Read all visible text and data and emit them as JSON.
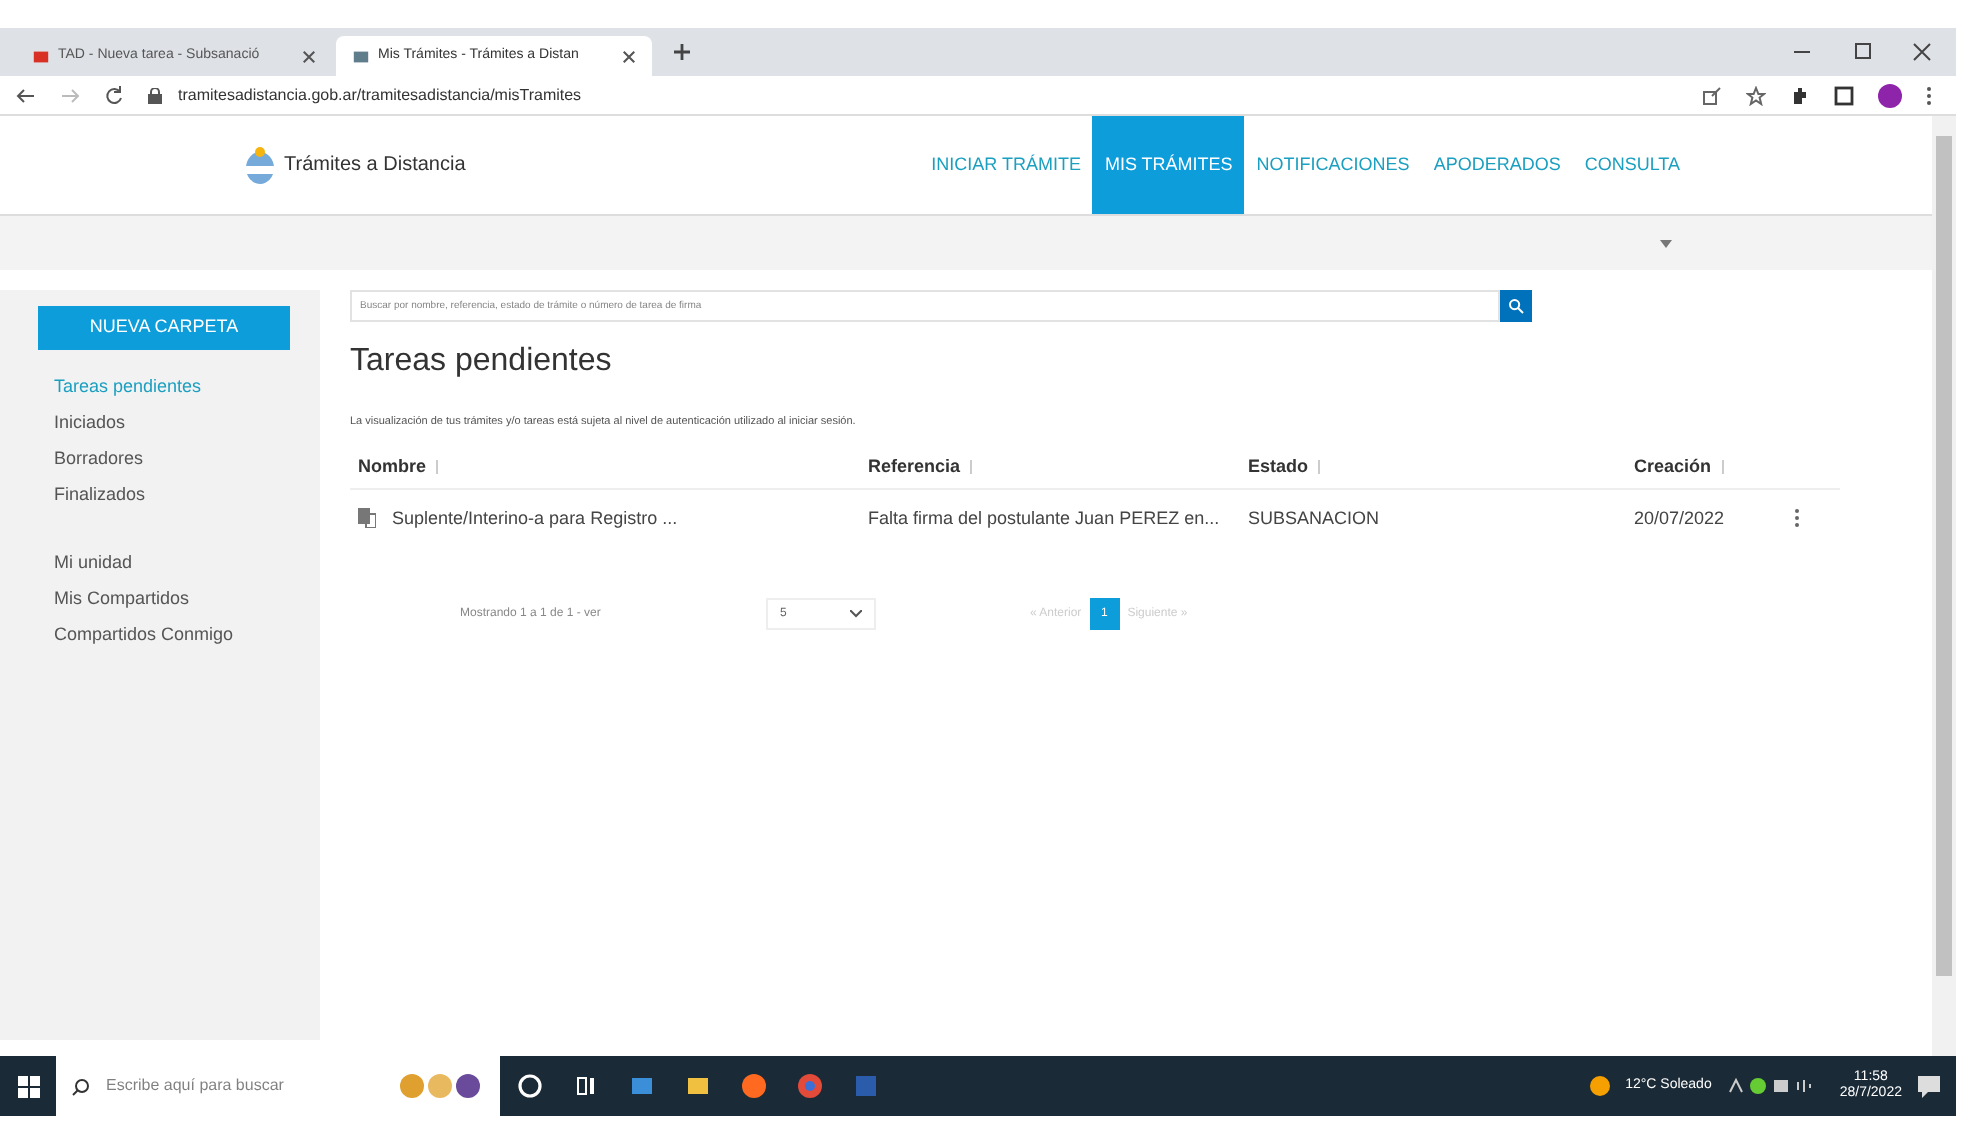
{
  "browser": {
    "tabs": [
      {
        "title": "TAD - Nueva tarea - Subsanació",
        "selected": false
      },
      {
        "title": "Mis Trámites - Trámites a Distan",
        "selected": true
      }
    ],
    "url": "tramitesadistancia.gob.ar/tramitesadistancia/misTramites"
  },
  "header": {
    "site_title": "Trámites a Distancia",
    "nav": [
      {
        "label": "INICIAR TRÁMITE",
        "selected": false
      },
      {
        "label": "MIS TRÁMITES",
        "selected": true
      },
      {
        "label": "NOTIFICACIONES",
        "selected": false
      },
      {
        "label": "APODERADOS",
        "selected": false
      },
      {
        "label": "CONSULTA",
        "selected": false
      }
    ]
  },
  "sidebar": {
    "new_folder_button": "NUEVA CARPETA",
    "groups": [
      [
        {
          "label": "Tareas pendientes",
          "selected": true
        },
        {
          "label": "Iniciados",
          "selected": false
        },
        {
          "label": "Borradores",
          "selected": false
        },
        {
          "label": "Finalizados",
          "selected": false
        }
      ],
      [
        {
          "label": "Mi unidad",
          "selected": false
        },
        {
          "label": "Mis Compartidos",
          "selected": false
        },
        {
          "label": "Compartidos Conmigo",
          "selected": false
        }
      ]
    ]
  },
  "search": {
    "placeholder": "Buscar por nombre, referencia, estado de trámite o número de tarea de firma"
  },
  "heading": "Tareas pendientes",
  "notice": "La visualización de tus trámites y/o tareas está sujeta al nivel de autenticación utilizado al iniciar sesión.",
  "table": {
    "columns": [
      "Nombre",
      "Referencia",
      "Estado",
      "Creación"
    ],
    "rows": [
      {
        "nombre": "Suplente/Interino-a para Registro ...",
        "referencia": "Falta firma del postulante Juan PEREZ en...",
        "estado": "SUBSANACION",
        "creacion": "20/07/2022"
      }
    ]
  },
  "pagination": {
    "summary": "Mostrando 1 a 1 de 1 - ver",
    "page_size": "5",
    "previous": "« Anterior",
    "pages": [
      {
        "label": "1",
        "selected": true
      }
    ],
    "next": "Siguiente »"
  },
  "taskbar": {
    "search_placeholder": "Escribe aquí para buscar",
    "weather": "12°C Soleado",
    "time": "11:58",
    "date": "28/7/2022"
  }
}
